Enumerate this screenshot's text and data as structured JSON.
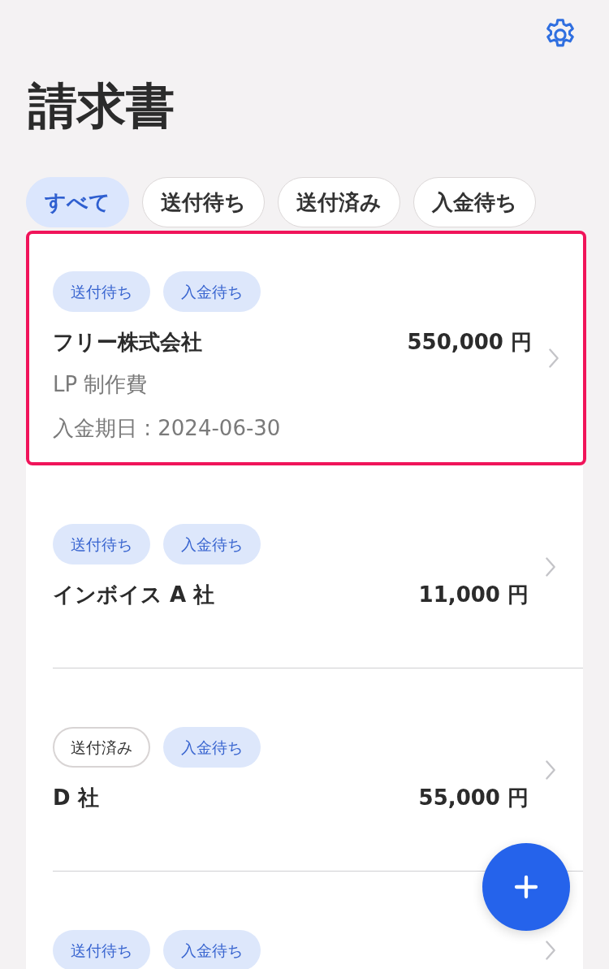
{
  "header": {
    "title": "請求書"
  },
  "filters": [
    {
      "label": "すべて",
      "selected": true
    },
    {
      "label": "送付待ち",
      "selected": false
    },
    {
      "label": "送付済み",
      "selected": false
    },
    {
      "label": "入金待ち",
      "selected": false
    }
  ],
  "invoices": [
    {
      "selected": true,
      "tags": [
        {
          "label": "送付待ち",
          "kind": "pending"
        },
        {
          "label": "入金待ち",
          "kind": "pending"
        }
      ],
      "client": "フリー株式会社",
      "amount": "550,000 円",
      "description": "LP 制作費",
      "due_date": "入金期日 : 2024-06-30"
    },
    {
      "selected": false,
      "tags": [
        {
          "label": "送付待ち",
          "kind": "pending"
        },
        {
          "label": "入金待ち",
          "kind": "pending"
        }
      ],
      "client": "インボイス A 社",
      "amount": "11,000 円"
    },
    {
      "selected": false,
      "tags": [
        {
          "label": "送付済み",
          "kind": "done"
        },
        {
          "label": "入金待ち",
          "kind": "pending"
        }
      ],
      "client": "D 社",
      "amount": "55,000 円"
    },
    {
      "selected": false,
      "tags": [
        {
          "label": "送付待ち",
          "kind": "pending"
        },
        {
          "label": "入金待ち",
          "kind": "pending"
        }
      ]
    }
  ]
}
